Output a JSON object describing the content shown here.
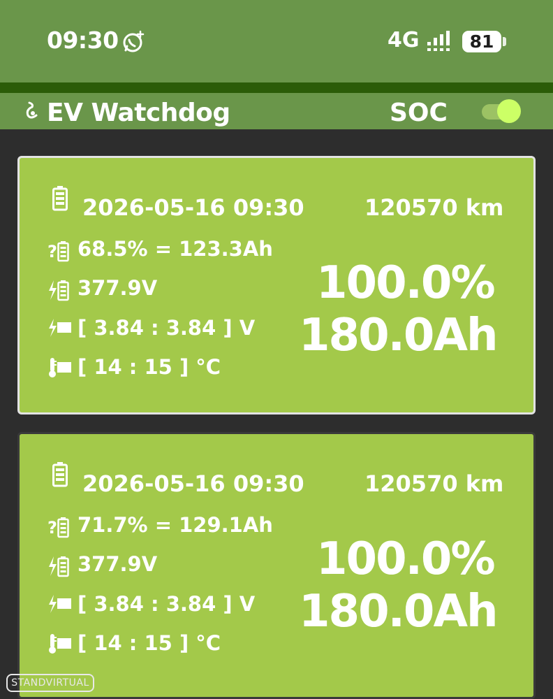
{
  "status_bar": {
    "time": "09:30",
    "network": "4G",
    "battery_level": "81",
    "icons": [
      "whatsapp-icon",
      "signal-icon",
      "battery-icon"
    ]
  },
  "app_bar": {
    "title": "EV Watchdog",
    "soc_label": "SOC",
    "toggle_on": true,
    "icon": "app-logo-icon"
  },
  "cards": [
    {
      "datetime": "2026-05-16 09:30",
      "odometer": "120570 km",
      "soc_line": "68.5% = 123.3Ah",
      "voltage": "377.9V",
      "cell_voltage": "[ 3.84 : 3.84 ] V",
      "temperature": "[ 14 : 15 ] °C",
      "soh_percent": "100.0%",
      "capacity": "180.0Ah"
    },
    {
      "datetime": "2026-05-16 09:30",
      "odometer": "120570 km",
      "soc_line": "71.7% = 129.1Ah",
      "voltage": "377.9V",
      "cell_voltage": "[ 3.84 : 3.84 ] V",
      "temperature": "[ 14 : 15 ] °C",
      "soh_percent": "100.0%",
      "capacity": "180.0Ah"
    }
  ],
  "watermark": "STANDVIRTUAL",
  "colors": {
    "status_bar": "#6a964a",
    "app_bar_line": "#2b5c08",
    "card": "#a3c94a",
    "background": "#2d2d2d",
    "toggle_knob": "#ccff66"
  }
}
